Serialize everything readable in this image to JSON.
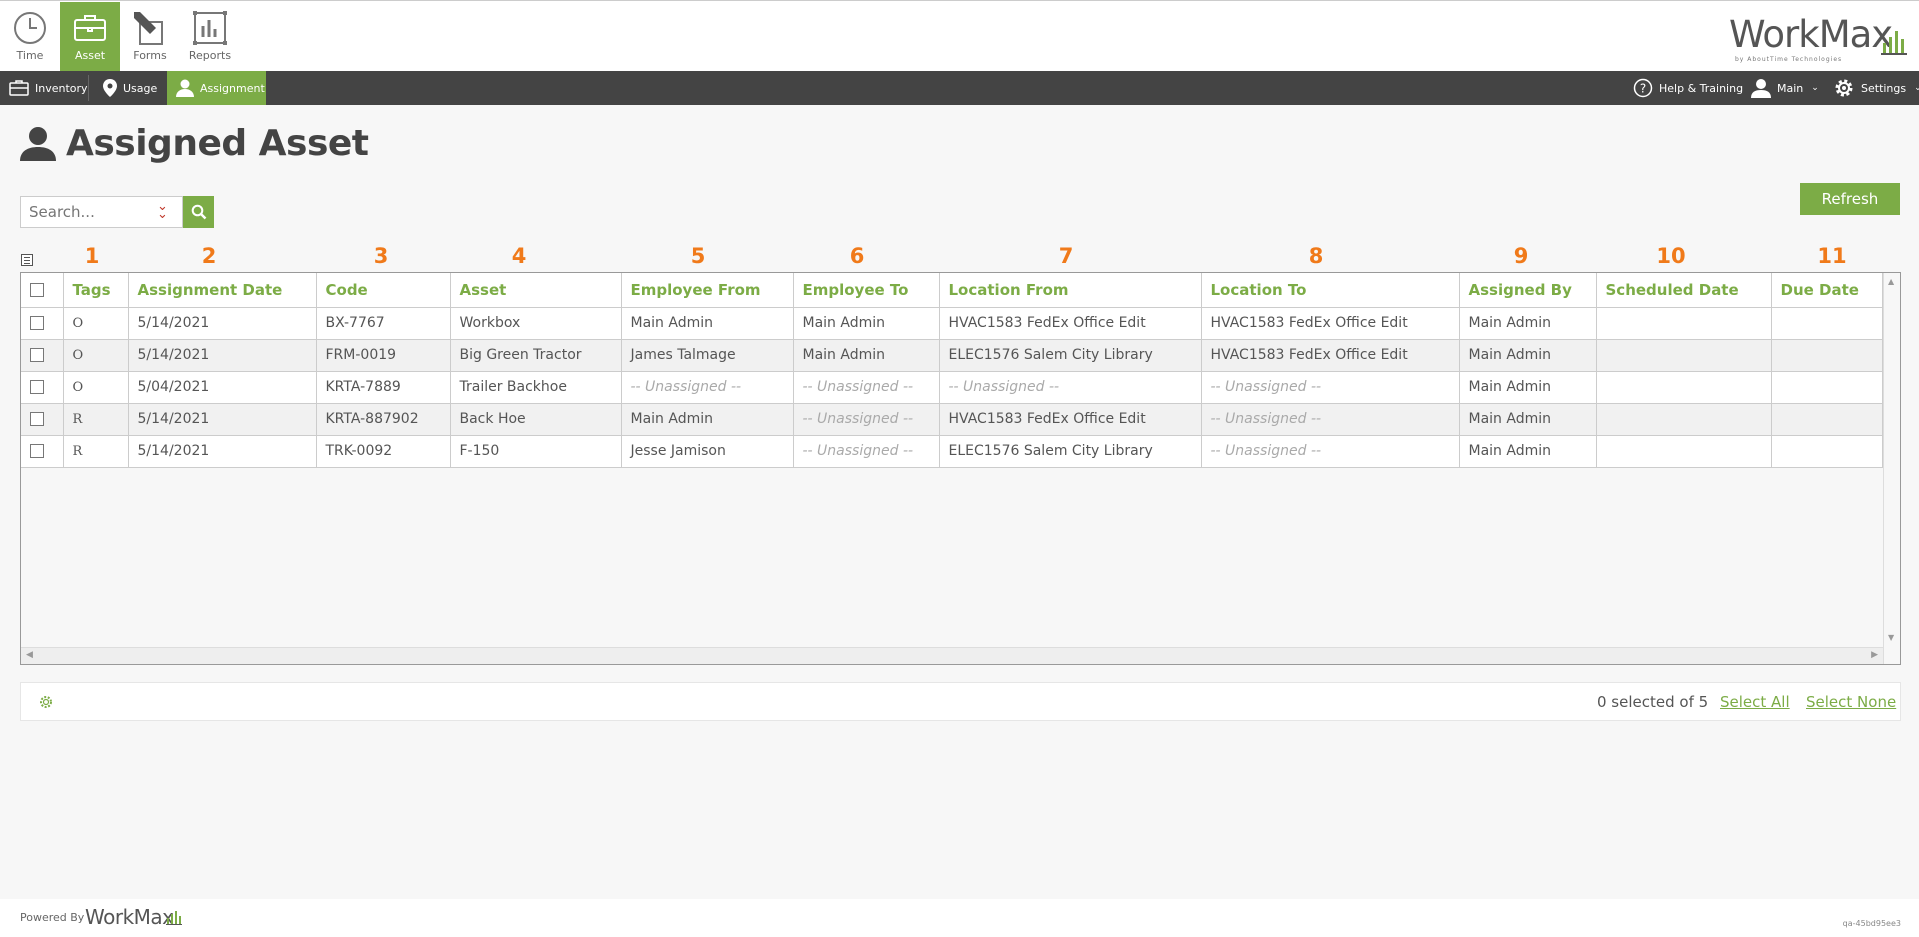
{
  "modules": [
    {
      "label": "Time",
      "icon": "clock-icon",
      "active": false
    },
    {
      "label": "Asset",
      "icon": "briefcase-icon",
      "active": true
    },
    {
      "label": "Forms",
      "icon": "pencil-icon",
      "active": false
    },
    {
      "label": "Reports",
      "icon": "chart-icon",
      "active": false
    }
  ],
  "brand": {
    "name": "WorkMax",
    "tagline": "by AboutTime Technologies"
  },
  "subnav": {
    "inventory": "Inventory",
    "usage": "Usage",
    "assignment": "Assignment",
    "help": "Help & Training",
    "user": "Main",
    "settings": "Settings"
  },
  "page": {
    "title": "Assigned Asset"
  },
  "search": {
    "placeholder": "Search..."
  },
  "toolbar": {
    "refresh_label": "Refresh"
  },
  "column_numbers": [
    "1",
    "2",
    "3",
    "4",
    "5",
    "6",
    "7",
    "8",
    "9",
    "10",
    "11"
  ],
  "table": {
    "headers": {
      "tags": "Tags",
      "assignment_date": "Assignment Date",
      "code": "Code",
      "asset": "Asset",
      "employee_from": "Employee From",
      "employee_to": "Employee To",
      "location_from": "Location From",
      "location_to": "Location To",
      "assigned_by": "Assigned By",
      "scheduled_date": "Scheduled Date",
      "due_date": "Due Date"
    },
    "rows": [
      {
        "tags": "O",
        "assignment_date": "5/14/2021",
        "code": "BX-7767",
        "asset": "Workbox",
        "employee_from": "Main Admin",
        "employee_to": "Main Admin",
        "location_from": "HVAC1583 FedEx Office Edit",
        "location_to": "HVAC1583 FedEx Office Edit",
        "assigned_by": "Main Admin",
        "scheduled_date": "",
        "due_date": ""
      },
      {
        "tags": "O",
        "assignment_date": "5/14/2021",
        "code": "FRM-0019",
        "asset": "Big Green Tractor",
        "employee_from": "James Talmage",
        "employee_to": "Main Admin",
        "location_from": "ELEC1576 Salem City Library",
        "location_to": "HVAC1583 FedEx Office Edit",
        "assigned_by": "Main Admin",
        "scheduled_date": "",
        "due_date": ""
      },
      {
        "tags": "O",
        "assignment_date": "5/04/2021",
        "code": "KRTA-7889",
        "asset": "Trailer Backhoe",
        "employee_from": "-- Unassigned --",
        "employee_to": "-- Unassigned --",
        "location_from": "-- Unassigned --",
        "location_to": "-- Unassigned --",
        "assigned_by": "Main Admin",
        "scheduled_date": "",
        "due_date": ""
      },
      {
        "tags": "R",
        "assignment_date": "5/14/2021",
        "code": "KRTA-887902",
        "asset": "Back Hoe",
        "employee_from": "Main Admin",
        "employee_to": "-- Unassigned --",
        "location_from": "HVAC1583 FedEx Office Edit",
        "location_to": "-- Unassigned --",
        "assigned_by": "Main Admin",
        "scheduled_date": "",
        "due_date": ""
      },
      {
        "tags": "R",
        "assignment_date": "5/14/2021",
        "code": "TRK-0092",
        "asset": "F-150",
        "employee_from": "Jesse Jamison",
        "employee_to": "-- Unassigned --",
        "location_from": "ELEC1576 Salem City Library",
        "location_to": "-- Unassigned --",
        "assigned_by": "Main Admin",
        "scheduled_date": "",
        "due_date": ""
      }
    ]
  },
  "footer_toolbar": {
    "selection_count": "0 selected of 5",
    "select_all": "Select All",
    "select_none": "Select None"
  },
  "page_footer": {
    "powered_by": "Powered By",
    "logo": "WorkMax",
    "version": "qa-45bd95ee3"
  },
  "colors": {
    "accent": "#7cac46",
    "nav_dark": "#444444",
    "column_number": "#f07a1a"
  }
}
